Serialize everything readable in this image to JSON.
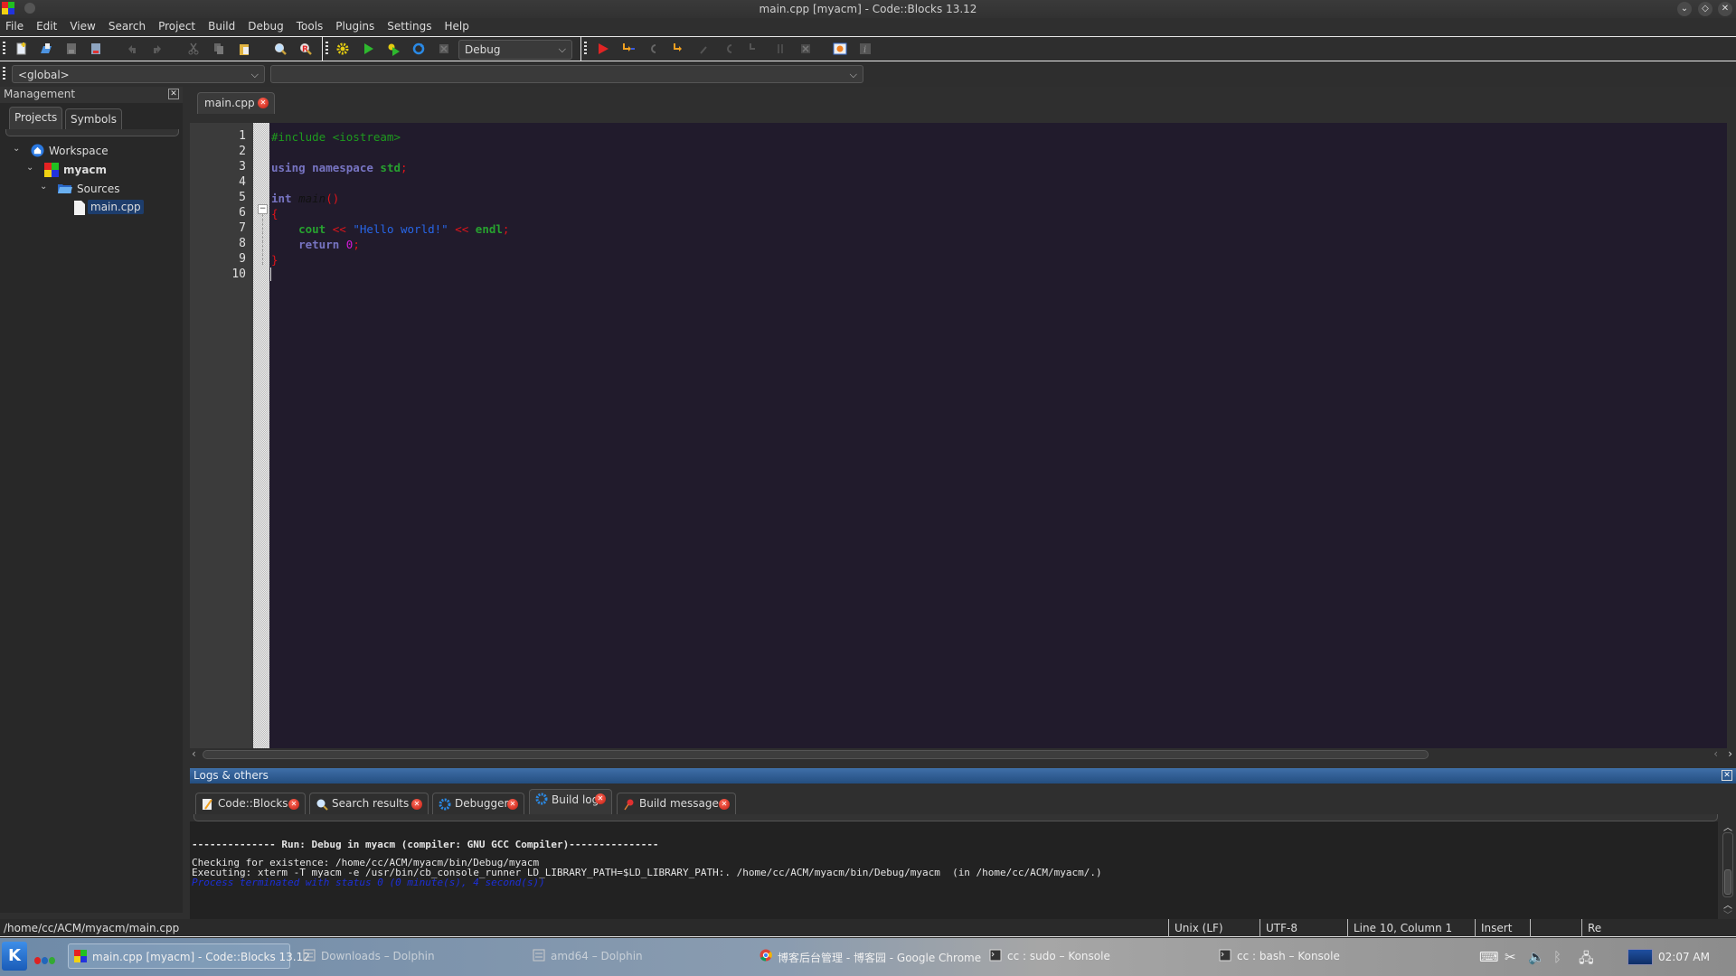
{
  "window": {
    "title": "main.cpp [myacm] - Code::Blocks 13.12",
    "controls": [
      "minimize",
      "maximize",
      "close"
    ]
  },
  "menubar": {
    "items": [
      "File",
      "Edit",
      "View",
      "Search",
      "Project",
      "Build",
      "Debug",
      "Tools",
      "Plugins",
      "Settings",
      "Help"
    ]
  },
  "toolbar": {
    "main_icons": [
      "new-file-icon",
      "open-icon",
      "save-icon",
      "save-all-icon",
      "undo-icon",
      "redo-icon",
      "cut-icon",
      "copy-icon",
      "paste-icon",
      "find-icon",
      "replace-icon"
    ],
    "compiler_icons": [
      "build-icon",
      "run-icon",
      "build-run-icon",
      "rebuild-icon",
      "abort-icon"
    ],
    "build_target": "Debug",
    "debugger_icons": [
      "debug-start-icon",
      "run-to-cursor-icon",
      "next-line-icon",
      "step-into-icon",
      "step-out-icon",
      "next-instruction-icon",
      "step-into-instruction-icon",
      "break-icon",
      "stop-debugger-icon",
      "debug-windows-icon",
      "info-icon"
    ]
  },
  "scopebar": {
    "scope": "<global>",
    "symbol": ""
  },
  "management": {
    "title": "Management",
    "tabs": [
      "Projects",
      "Symbols"
    ],
    "active_tab": "Projects",
    "tree": {
      "workspace": "Workspace",
      "project": "myacm",
      "folder": "Sources",
      "file": "main.cpp"
    }
  },
  "editor": {
    "tab": "main.cpp",
    "line_numbers": [
      "1",
      "2",
      "3",
      "4",
      "5",
      "6",
      "7",
      "8",
      "9",
      "10"
    ],
    "lines": [
      [
        {
          "t": "#include <iostream>",
          "c": "pre"
        }
      ],
      [],
      [
        {
          "t": "using namespace ",
          "c": "kw"
        },
        {
          "t": "std",
          "c": "id"
        },
        {
          "t": ";",
          "c": "op"
        }
      ],
      [],
      [
        {
          "t": "int ",
          "c": "kw"
        },
        {
          "t": "main",
          "c": "fn"
        },
        {
          "t": "()",
          "c": "op"
        }
      ],
      [
        {
          "t": "{",
          "c": "op"
        }
      ],
      [
        {
          "t": "    ",
          "c": ""
        },
        {
          "t": "cout",
          "c": "id"
        },
        {
          "t": " << ",
          "c": "op"
        },
        {
          "t": "\"Hello world!\"",
          "c": "str"
        },
        {
          "t": " << ",
          "c": "op"
        },
        {
          "t": "endl",
          "c": "id"
        },
        {
          "t": ";",
          "c": "op"
        }
      ],
      [
        {
          "t": "    ",
          "c": ""
        },
        {
          "t": "return ",
          "c": "kw"
        },
        {
          "t": "0",
          "c": "num"
        },
        {
          "t": ";",
          "c": "op"
        }
      ],
      [
        {
          "t": "}",
          "c": "op"
        }
      ],
      []
    ]
  },
  "logs": {
    "title": "Logs & others",
    "tabs": [
      {
        "label": "Code::Blocks",
        "icon": "note-icon"
      },
      {
        "label": "Search results",
        "icon": "magnifier-icon"
      },
      {
        "label": "Debugger",
        "icon": "gear-icon"
      },
      {
        "label": "Build log",
        "icon": "gear-icon"
      },
      {
        "label": "Build messages",
        "icon": "pin-icon"
      }
    ],
    "active_tab": "Build log",
    "lines": [
      "-------------- Run: Debug in myacm (compiler: GNU GCC Compiler)---------------",
      "Checking for existence: /home/cc/ACM/myacm/bin/Debug/myacm",
      "Executing: xterm -T myacm -e /usr/bin/cb_console_runner LD_LIBRARY_PATH=$LD_LIBRARY_PATH:. /home/cc/ACM/myacm/bin/Debug/myacm  (in /home/cc/ACM/myacm/.)",
      "Process terminated with status 0 (0 minute(s), 4 second(s))"
    ]
  },
  "statusbar": {
    "path": "/home/cc/ACM/myacm/main.cpp",
    "eol": "Unix (LF)",
    "encoding": "UTF-8",
    "position": "Line 10, Column 1",
    "mode": "Insert",
    "readwrite": "Re"
  },
  "taskbar": {
    "tasks": [
      {
        "label": "main.cpp [myacm] - Code::Blocks 13.12",
        "active": true
      },
      {
        "label": "Downloads – Dolphin",
        "active": false
      },
      {
        "label": "amd64 – Dolphin",
        "active": false
      },
      {
        "label": "博客后台管理 - 博客园 - Google Chrome",
        "active": false
      },
      {
        "label": "cc : sudo – Konsole",
        "active": false
      },
      {
        "label": "cc : bash – Konsole",
        "active": false
      }
    ],
    "clock": "02:07 AM"
  },
  "colors": {
    "accent_blue": "#2d5e95",
    "code_bg": "#211b2c",
    "close_badge": "#c41b0f"
  }
}
